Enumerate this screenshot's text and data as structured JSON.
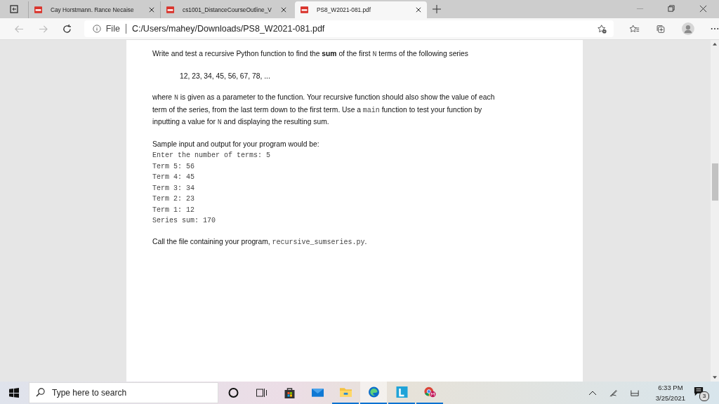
{
  "tabs": [
    {
      "title": "Cay Horstmann. Rance Necaise",
      "selected": false
    },
    {
      "title": "cs1001_DistanceCourseOutline_V",
      "selected": false
    },
    {
      "title": "PS8_W2021-081.pdf",
      "selected": true
    }
  ],
  "address_bar": {
    "scheme_label": "File",
    "url": "C:/Users/mahey/Downloads/PS8_W2021-081.pdf"
  },
  "document": {
    "blocks": [
      {
        "kind": "para",
        "lines": [
          [
            {
              "t": "Write and test a recursive Python function to find the ",
              "kind": "text"
            },
            {
              "t": "sum",
              "kind": "bold"
            },
            {
              "t": " of the first ",
              "kind": "text"
            },
            {
              "t": "N",
              "kind": "code"
            },
            {
              "t": " terms of the following series",
              "kind": "text"
            }
          ]
        ]
      },
      {
        "kind": "series",
        "lines": [
          [
            {
              "t": "12, 23, 34, 45, 56, 67, 78, ...",
              "kind": "text"
            }
          ]
        ]
      },
      {
        "kind": "para",
        "lines": [
          [
            {
              "t": "where ",
              "kind": "text"
            },
            {
              "t": "N",
              "kind": "code"
            },
            {
              "t": " is given as a parameter to the function.  Your recursive function should also show the value of each",
              "kind": "text"
            }
          ],
          [
            {
              "t": "term of the series, from the last term down to the first term.  Use a ",
              "kind": "text"
            },
            {
              "t": "main",
              "kind": "code"
            },
            {
              "t": " function to test your function by",
              "kind": "text"
            }
          ],
          [
            {
              "t": "inputting a value for ",
              "kind": "text"
            },
            {
              "t": "N",
              "kind": "code"
            },
            {
              "t": " and displaying the resulting sum.",
              "kind": "text"
            }
          ]
        ]
      },
      {
        "kind": "para",
        "lines": [
          [
            {
              "t": "Sample input and output for your program would be:",
              "kind": "text"
            }
          ]
        ]
      },
      {
        "kind": "code",
        "lines": [
          [
            {
              "t": "Enter the number of terms: 5",
              "kind": "code"
            }
          ],
          [
            {
              "t": "Term 5: 56",
              "kind": "code"
            }
          ],
          [
            {
              "t": "Term 4: 45",
              "kind": "code"
            }
          ],
          [
            {
              "t": "Term 3: 34",
              "kind": "code"
            }
          ],
          [
            {
              "t": "Term 2: 23",
              "kind": "code"
            }
          ],
          [
            {
              "t": "Term 1: 12",
              "kind": "code"
            }
          ],
          [
            {
              "t": "Series sum: 170",
              "kind": "code"
            }
          ]
        ]
      },
      {
        "kind": "para",
        "lines": [
          [
            {
              "t": "Call the file containing your program, ",
              "kind": "text"
            },
            {
              "t": "recursive_sumseries.py",
              "kind": "code"
            },
            {
              "t": ".",
              "kind": "text"
            }
          ]
        ]
      }
    ]
  },
  "taskbar": {
    "search": {
      "placeholder": "Type here to search"
    },
    "apps": [
      {
        "kind": "cortana",
        "running": false,
        "selected": false
      },
      {
        "kind": "taskview",
        "running": false,
        "selected": false
      },
      {
        "kind": "store",
        "running": false,
        "selected": false
      },
      {
        "kind": "mail",
        "running": false,
        "selected": false
      },
      {
        "kind": "explorer",
        "running": true,
        "selected": false
      },
      {
        "kind": "edge",
        "running": true,
        "selected": true
      },
      {
        "kind": "lapp",
        "running": true,
        "selected": false
      },
      {
        "kind": "chrome",
        "running": true,
        "selected": false
      }
    ],
    "clock": {
      "time": "6:33 PM",
      "date": "3/25/2021"
    },
    "notifications": {
      "count": "3"
    }
  }
}
